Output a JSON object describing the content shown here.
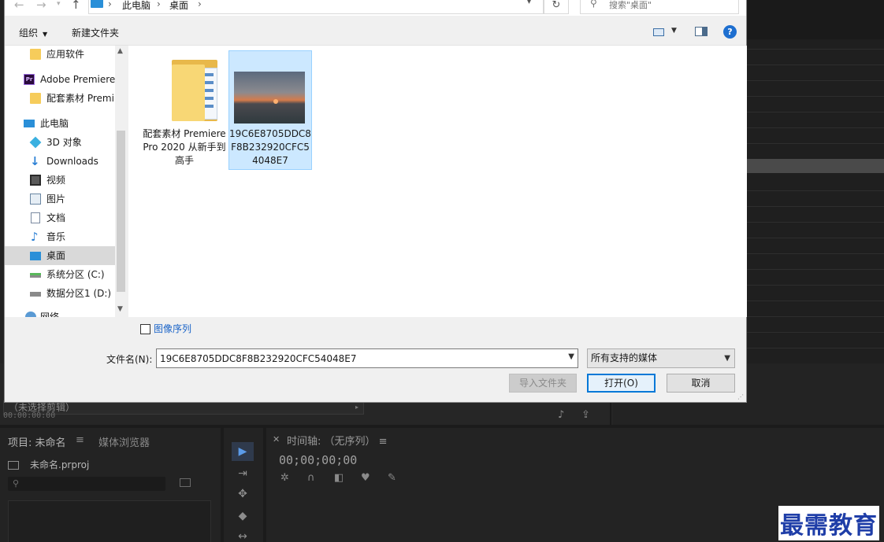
{
  "dialog": {
    "address": {
      "crumbs": [
        "此电脑",
        "桌面"
      ],
      "search_placeholder": "搜索\"桌面\""
    },
    "toolbar": {
      "organize": "组织",
      "new_folder": "新建文件夹"
    },
    "nav": [
      {
        "label": "应用软件",
        "icon": "folder-icon"
      },
      {
        "label": "Adobe Premiere",
        "icon": "premiere-icon"
      },
      {
        "label": "配套素材 Premi",
        "icon": "folder-icon"
      },
      {
        "label": "此电脑",
        "icon": "computer-icon"
      },
      {
        "label": "3D 对象",
        "icon": "3d-objects-icon"
      },
      {
        "label": "Downloads",
        "icon": "download-icon"
      },
      {
        "label": "视频",
        "icon": "video-icon"
      },
      {
        "label": "图片",
        "icon": "pictures-icon"
      },
      {
        "label": "文档",
        "icon": "documents-icon"
      },
      {
        "label": "音乐",
        "icon": "music-icon"
      },
      {
        "label": "桌面",
        "icon": "desktop-icon"
      },
      {
        "label": "系统分区 (C:)",
        "icon": "drive-icon"
      },
      {
        "label": "数据分区1 (D:)",
        "icon": "drive-icon"
      },
      {
        "label": "网络",
        "icon": "network-icon"
      }
    ],
    "files": [
      {
        "name": "配套素材 Premiere Pro 2020 从新手到高手",
        "type": "folder"
      },
      {
        "name": "19C6E8705DDC8F8B232920CFC54048E7",
        "type": "image",
        "selected": true
      }
    ],
    "image_sequence_label": "图像序列",
    "filename_label": "文件名(N):",
    "filename_value": "19C6E8705DDC8F8B232920CFC54048E7",
    "filetype_value": "所有支持的媒体",
    "buttons": {
      "import_folder": "导入文件夹",
      "open": "打开(O)",
      "cancel": "取消"
    }
  },
  "premiere": {
    "source_clip": "（未选择剪辑）",
    "source_tc": "00:00:00:00",
    "project_tab": "项目: 未命名",
    "media_browser_tab": "媒体浏览器",
    "project_file": "未命名.prproj",
    "timeline_tab": "时间轴: （无序列）",
    "timeline_tc": "00;00;00;00"
  },
  "watermark": "最需教育"
}
